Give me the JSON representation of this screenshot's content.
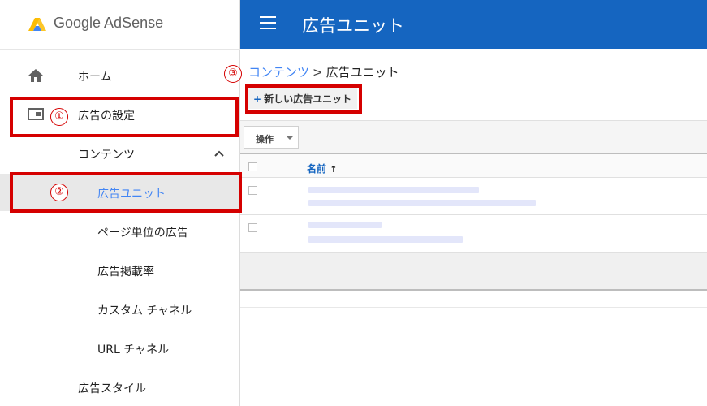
{
  "brand": {
    "name": "Google AdSense"
  },
  "sidebar": {
    "items": [
      {
        "label": "ホーム"
      },
      {
        "label": "広告の設定"
      },
      {
        "label": "コンテンツ"
      },
      {
        "label": "広告ユニット"
      },
      {
        "label": "ページ単位の広告"
      },
      {
        "label": "広告掲載率"
      },
      {
        "label": "カスタム チャネル"
      },
      {
        "label": "URL チャネル"
      },
      {
        "label": "広告スタイル"
      }
    ]
  },
  "topbar": {
    "title": "広告ユニット"
  },
  "breadcrumb": {
    "parent": "コンテンツ",
    "separator": ">",
    "current": "広告ユニット"
  },
  "toolbar": {
    "new_button_label": "新しい広告ユニット",
    "plus_symbol": "+"
  },
  "ops": {
    "label": "操作"
  },
  "table": {
    "column_name": "名前",
    "sort_arrow": "↑"
  },
  "annotations": {
    "one": "①",
    "two": "②",
    "three": "③"
  },
  "colors": {
    "accent": "#4285f4",
    "topbar": "#1565c0",
    "highlight": "#d50000"
  }
}
